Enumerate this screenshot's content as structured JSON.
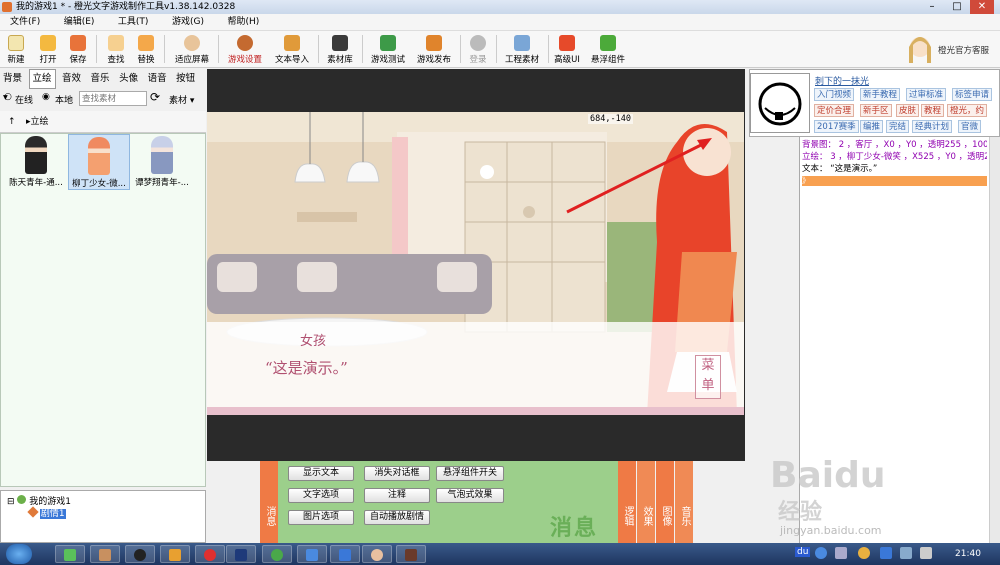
{
  "window": {
    "title": "我的游戏1 * - 橙光文字游戏制作工具v1.38.142.0328",
    "minimize": "–",
    "maximize": "□",
    "close": "✕"
  },
  "menu": [
    "文件(F)",
    "编辑(E)",
    "工具(T)",
    "游戏(G)",
    "帮助(H)"
  ],
  "toolbar": {
    "new": "新建",
    "open": "打开",
    "save": "保存",
    "find": "查找",
    "replace": "替换",
    "fit_screen": "适应屏幕",
    "game_settings": "游戏设置",
    "text_import": "文本导入",
    "asset_lib": "素材库",
    "game_test": "游戏测试",
    "game_publish": "游戏发布",
    "login": "登录",
    "project_assets": "工程素材",
    "advanced_ui": "高级UI",
    "float_widget": "悬浮组件",
    "support": "橙光官方客服"
  },
  "left": {
    "tabs": [
      "背景",
      "立绘",
      "音效",
      "音乐",
      "头像",
      "语音",
      "按钮"
    ],
    "active_tab": 1,
    "online": "在线",
    "local": "本地",
    "search_placeholder": "查找素材",
    "asset_dropdown": "素材",
    "path": "立绘",
    "assets": [
      "陈天青年-通...",
      "柳丁少女-微...",
      "谭梦翔青年-..."
    ]
  },
  "tree": {
    "root": "我的游戏1",
    "child": "剧情1"
  },
  "stage": {
    "coord": "684,-140",
    "name": "女孩",
    "dialogue": "“这是演示。”",
    "menu_badge": "菜单"
  },
  "bottom": {
    "left_tab": "消息",
    "buttons": [
      "显示文本",
      "消失对话框",
      "悬浮组件开关",
      "文字选项",
      "注释",
      "气泡式效果",
      "图片选项",
      "自动播放剧情"
    ],
    "watermark": "消息",
    "right_tabs": [
      "逻辑",
      "效果",
      "图像",
      "音乐"
    ]
  },
  "right": {
    "user": "刺下的一抹光",
    "tags_row1": [
      "入门视频",
      "新手教程",
      "过审标准",
      "标签申请"
    ],
    "tags_row2": [
      "定价合理",
      "新手区",
      "皮肤",
      "教程",
      "橙光，约"
    ],
    "tags_row3": [
      "2017赛季",
      "编推",
      "完结",
      "经典计划",
      "官微"
    ],
    "script": [
      "背景图： 2 ，客厅 ，X0 ，Y0 ，透明255 ，100% ，10",
      "立绘： 3 ，柳丁少女-微笑 ，X525 ，Y0 ，透明255",
      "文本： “这是演示。”"
    ],
    "cursor_marker": "》"
  },
  "watermark": {
    "brand": "Baidu",
    "cn": "经验",
    "url": "jingyan.baidu.com"
  },
  "taskbar": {
    "time": "21:40",
    "tray_text": "du"
  },
  "colors": {
    "accent_orange": "#f07a3a",
    "green_panel": "#9ccf8b",
    "tab_orange": "#ef7a45"
  }
}
